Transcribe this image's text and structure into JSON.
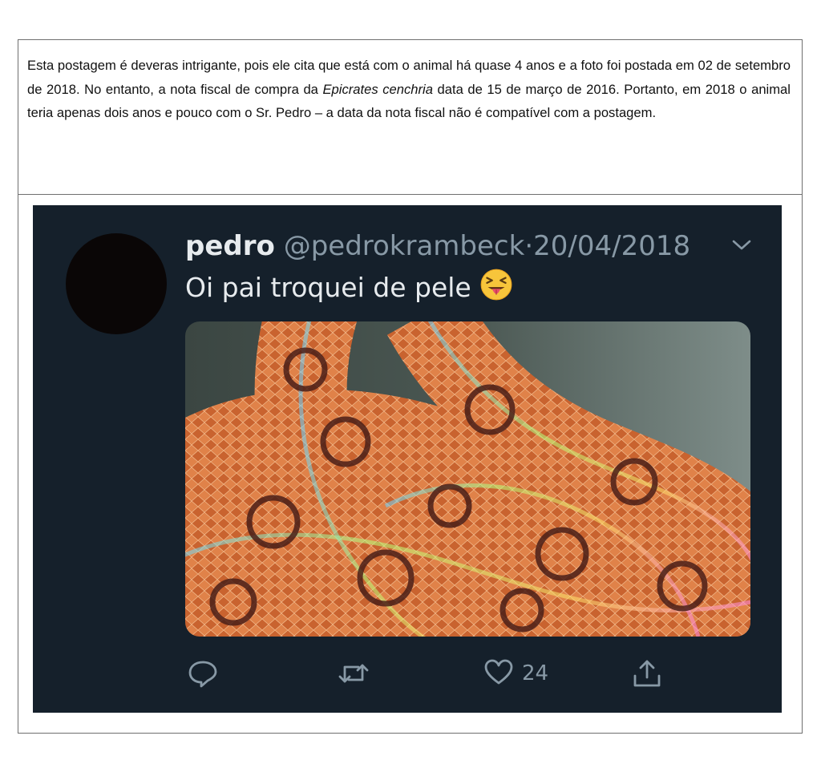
{
  "document": {
    "paragraph_part1": "Esta postagem é deveras intrigante, pois ele cita que está com o animal há quase 4 anos e a foto foi postada em 02 de setembro de 2018. No entanto, a nota fiscal de compra da ",
    "species": "Epicrates cenchria",
    "paragraph_part2": " data de 15 de março de 2016. Portanto, em 2018 o animal teria apenas dois anos e pouco com o Sr. Pedro – a data da nota fiscal não é compatível com a postagem."
  },
  "tweet": {
    "display_name": "pedro",
    "handle": "@pedrokrambeck",
    "separator": "·",
    "date": "20/04/2018",
    "text": "Oi pai troquei de pele",
    "like_count": "24"
  },
  "icons": {
    "chevron": "chevron-down-icon",
    "emoji": "squinting-face-with-tongue-emoji",
    "reply": "reply-icon",
    "retweet": "retweet-icon",
    "like": "heart-icon",
    "share": "share-icon"
  },
  "colors": {
    "tweet_background": "#15202b",
    "primary_text": "#e7ebee",
    "secondary_text": "#8899a6"
  }
}
